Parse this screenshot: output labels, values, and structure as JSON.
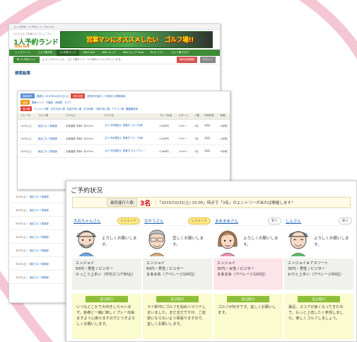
{
  "colors": {
    "accent_green": "#3e8a35",
    "alert_red": "#d0021b",
    "link_blue": "#1a5fb4",
    "legend_gold": "#ffe98a"
  },
  "back_page": {
    "logo": {
      "tagline": "1人でゴルフを楽しむコミュニティ",
      "title": "1人予約ランド",
      "sub": "Wild Golf"
    },
    "banner": {
      "text": "営業マンにオススメしたい　ゴルフ場!!"
    },
    "nav": [
      "トップページ",
      "ゴルフ場予約",
      "1人予約ランド",
      "Wild Golf",
      "Wild カップ",
      "Wild カップ Gold",
      "RCオープン",
      "ゴルフ場ブログ"
    ],
    "subbar": {
      "menu": "▼ 1人予約ランド",
      "text": "ようこそゲストさん　ゴルフ場ガイド・1人予約ランドにログインする",
      "register": "無料会員登録",
      "login": "ログイン"
    },
    "result_title": "検索結果"
  },
  "results": {
    "filters_row1": {
      "tag": "検索条件",
      "link1": "希望日: 2015年10月31日(土)",
      "tag2": "条件変更",
      "link2": "全条件を保存して次回から簡単検索"
    },
    "filters_row2": {
      "tag": "地域",
      "items": [
        "関東エリア",
        "千葉県",
        "茨城県",
        "すべて"
      ]
    },
    "filters_row3": {
      "tag": "並び順",
      "items": [
        "ランキング順",
        "日付が近い順",
        "料金が安い順",
        "空き枠順",
        "人数が多い順",
        "クチコミ順",
        "開催確定順"
      ]
    },
    "headers": [
      "プレー日",
      "ゴルフ場",
      "アクセス",
      "プラン名",
      "プレー料金",
      "スタート",
      "人数",
      "予約状況",
      "詳細"
    ],
    "rows": [
      {
        "date": "10/31(土)",
        "course": "総武ゴルフ倶楽部",
        "access": "京葉道路 市原IC 約10km",
        "plan": "【1人予約限定】 昼食付 ゴルフ日和",
        "price": "4,500円",
        "start": "9:00〜",
        "count": "3名",
        "status": "☺☺☺",
        "detail": "★詳細"
      },
      {
        "date": "10/31(土)",
        "course": "総武ゴルフ倶楽部",
        "access": "京葉道路 市原IC 約10km",
        "plan": "【1人予約限定】 昼食付 プレー日和",
        "price": "4,200円",
        "start": "9:30〜",
        "count": "3名",
        "status": "☺☺☺",
        "detail": "★詳細"
      },
      {
        "date": "10/31(土)",
        "course": "総武ゴルフ倶楽部",
        "access": "京葉道路 市原IC 約10km",
        "plan": "【1人予約限定】 昼食付 セルフプレー",
        "price": "4,500円",
        "start": "10:00〜",
        "count": "2名",
        "status": "☺☺☺",
        "detail": "★詳細"
      }
    ],
    "side_rows": [
      {
        "date": "10/31(土)",
        "course": "総武ゴルフ倶楽部"
      },
      {
        "date": "10/31(土)",
        "course": "総武ゴルフ倶楽部"
      },
      {
        "date": "10/31(土)",
        "course": "総武ゴルフ倶楽部"
      },
      {
        "date": "10/31(土)",
        "course": "総武ゴルフ倶楽部"
      },
      {
        "date": "10/31(土)",
        "course": "総武ゴルフ倶楽部"
      },
      {
        "date": "10/31(土)",
        "course": "総武ゴルフ倶楽部"
      },
      {
        "date": "10/31(土)",
        "course": "総武ゴルフ倶楽部"
      }
    ]
  },
  "reservation": {
    "title": "ご予約状況",
    "label": "最低催行人数",
    "count": "3名",
    "message": "｜「2015/10/31(土) 15:00」時点で「3名」のエントリーがあれば開催します！",
    "participants": [
      {
        "name": "大石ちゃんさん",
        "badge": "レジェンド",
        "badge_type": "legend",
        "greeting": "よろしくお願いします。",
        "info1": "エンジョイ",
        "info2": "50代・男性 / ビジター",
        "info3": "けっこう上手い（平均スコア80台）",
        "intro_label": "自己紹介",
        "intro": "いつもどこかで大叩きしちゃいます。皆様と一緒に楽しくプレー出来ますよう心掛けますのでどうぞよろしくお願いします。",
        "info_bg": "gray"
      },
      {
        "name": "なかうさん",
        "badge": "レジェンド",
        "badge_type": "legend",
        "greeting": "宜しくお願いします。",
        "info1": "エンジョイ",
        "info2": "60代・男性 / ビジター",
        "info3": "まあまあ（アベレージ100位）",
        "intro_label": "自己紹介",
        "intro": "ライ街中にゴルフを始めハマツテしまいました。まだまだですが、ご迷惑にならないよう頑張りますので、宜しくお願いします。",
        "info_bg": "gray"
      },
      {
        "name": "まあまあさん",
        "badge": "新人",
        "badge_type": "beginner",
        "greeting": "よろしくお願いします。",
        "info1": "エンジョイ",
        "info2": "30代・女性 / ビジター",
        "info3": "まあまあ（アベレージ100位）",
        "intro_label": "自己紹介",
        "intro": "ゴルフが好きです。宜しくお願いします。",
        "info_bg": "pink"
      },
      {
        "name": "しんさん",
        "badge": "新人",
        "badge_type": "beginner",
        "greeting": "よろしくお願いします。",
        "info1": "エンジョイ＆アスリート",
        "info2": "30代・男性 / ビジター",
        "info3": "わりと上手い（アベレージ90位）",
        "intro_label": "自己紹介",
        "intro": "最近、スコアが良くなってきたので、もっと上達したく参加しました。楽しくゴルフしましょう。",
        "info_bg": "gray"
      }
    ]
  }
}
